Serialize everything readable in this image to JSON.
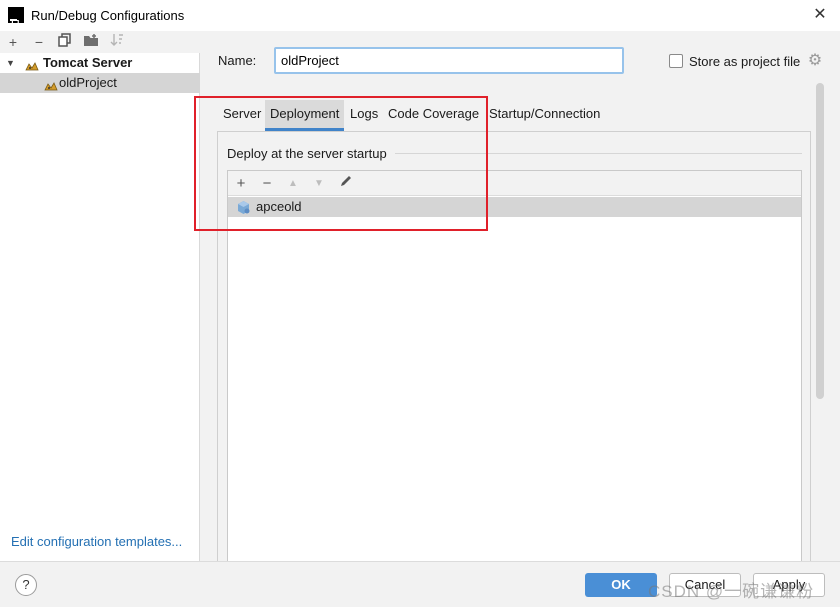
{
  "window": {
    "title": "Run/Debug Configurations",
    "logo_text": "IJ"
  },
  "left_toolbar": {
    "icons": [
      "add-icon",
      "remove-icon",
      "copy-icon",
      "folder-icon",
      "sort-icon"
    ]
  },
  "tree": {
    "group_label": "Tomcat Server",
    "item_label": "oldProject"
  },
  "edit_templates_label": "Edit configuration templates...",
  "form": {
    "name_label": "Name:",
    "name_value": "oldProject",
    "store_label": "Store as project file",
    "store_checked": false
  },
  "tabs": [
    {
      "label": "Server",
      "active": false
    },
    {
      "label": "Deployment",
      "active": true
    },
    {
      "label": "Logs",
      "active": false
    },
    {
      "label": "Code Coverage",
      "active": false
    },
    {
      "label": "Startup/Connection",
      "active": false
    }
  ],
  "deployment": {
    "section_title": "Deploy at the server startup",
    "items": [
      {
        "label": "apceold"
      }
    ]
  },
  "buttons": {
    "ok": "OK",
    "cancel": "Cancel",
    "apply": "Apply",
    "help": "?"
  },
  "watermark": "CSDN @一碗谦谦粉",
  "colors": {
    "accent": "#4083c9",
    "ok_button": "#4a8fd6",
    "link": "#2470b3",
    "highlight_box": "#e0202a"
  }
}
